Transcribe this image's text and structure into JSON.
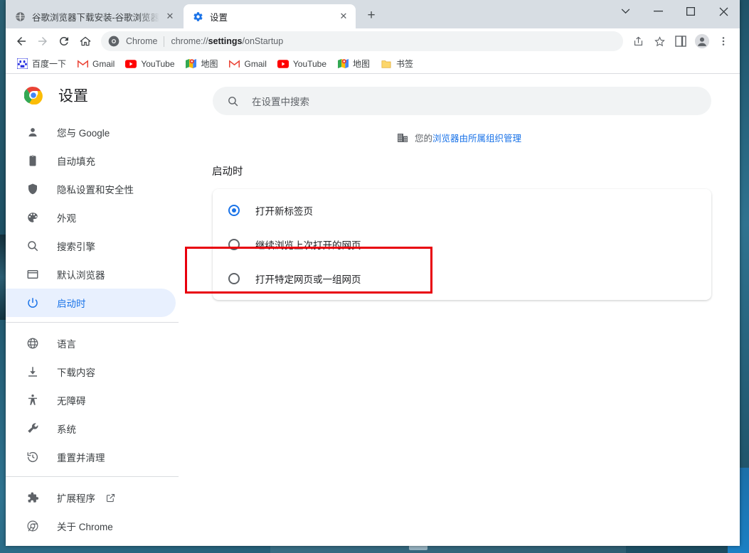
{
  "window": {
    "controls": [
      {
        "name": "tab-search",
        "glyph": "⌄"
      },
      {
        "name": "minimize",
        "glyph": "—"
      },
      {
        "name": "maximize",
        "glyph": "▢"
      },
      {
        "name": "close",
        "glyph": "✕"
      }
    ]
  },
  "tabs": [
    {
      "title": "谷歌浏览器下载安装-谷歌浏览器",
      "icon": "globe-icon",
      "active": false
    },
    {
      "title": "设置",
      "icon": "gear-icon",
      "active": true
    }
  ],
  "tab_close_glyph": "✕",
  "new_tab_glyph": "+",
  "toolbar": {
    "back_label": "←",
    "forward_label": "→",
    "reload_label": "⟳",
    "home_label": "⌂",
    "omnibox": {
      "scheme_label": "Chrome",
      "url_prefix": "chrome://",
      "url_bold": "settings",
      "url_suffix": "/onStartup",
      "full_url": "chrome://settings/onStartup"
    },
    "right_icons": [
      "share-icon",
      "star-icon",
      "side-panel-icon",
      "profile-avatar-icon",
      "more-menu-icon"
    ]
  },
  "bookmarks": [
    {
      "label": "百度一下",
      "icon": "baidu-icon"
    },
    {
      "label": "Gmail",
      "icon": "gmail-icon"
    },
    {
      "label": "YouTube",
      "icon": "youtube-icon"
    },
    {
      "label": "地图",
      "icon": "maps-icon"
    },
    {
      "label": "Gmail",
      "icon": "gmail-icon"
    },
    {
      "label": "YouTube",
      "icon": "youtube-icon"
    },
    {
      "label": "地图",
      "icon": "maps-icon"
    },
    {
      "label": "书签",
      "icon": "folder-icon"
    }
  ],
  "sidebar": {
    "title": "设置",
    "logo": "chrome-logo-icon",
    "group1": [
      {
        "label": "您与 Google",
        "icon": "person-icon",
        "active": false
      },
      {
        "label": "自动填充",
        "icon": "clipboard-icon",
        "active": false
      },
      {
        "label": "隐私设置和安全性",
        "icon": "shield-icon",
        "active": false
      },
      {
        "label": "外观",
        "icon": "palette-icon",
        "active": false
      },
      {
        "label": "搜索引擎",
        "icon": "search-icon",
        "active": false
      },
      {
        "label": "默认浏览器",
        "icon": "browser-window-icon",
        "active": false
      },
      {
        "label": "启动时",
        "icon": "power-icon",
        "active": true
      }
    ],
    "group2": [
      {
        "label": "语言",
        "icon": "globe-icon",
        "active": false
      },
      {
        "label": "下载内容",
        "icon": "download-icon",
        "active": false
      },
      {
        "label": "无障碍",
        "icon": "accessibility-icon",
        "active": false
      },
      {
        "label": "系统",
        "icon": "wrench-icon",
        "active": false
      },
      {
        "label": "重置并清理",
        "icon": "history-restore-icon",
        "active": false
      }
    ],
    "group3": [
      {
        "label": "扩展程序",
        "icon": "puzzle-icon",
        "external": true,
        "active": false
      },
      {
        "label": "关于 Chrome",
        "icon": "chrome-outline-icon",
        "external": false,
        "active": false
      }
    ]
  },
  "search": {
    "placeholder": "在设置中搜索",
    "icon": "search-icon"
  },
  "managed": {
    "icon": "organization-building-icon",
    "prefix": "您的",
    "link": "浏览器由所属组织管理"
  },
  "main": {
    "section_title": "启动时",
    "startup_options": [
      {
        "label": "打开新标签页",
        "checked": true,
        "highlighted": false
      },
      {
        "label": "继续浏览上次打开的网页",
        "checked": false,
        "highlighted": false
      },
      {
        "label": "打开特定网页或一组网页",
        "checked": false,
        "highlighted": true
      }
    ]
  },
  "colors": {
    "accent_blue": "#1a73e8",
    "active_nav_bg": "#e8f0fe",
    "annotation_red": "#e8000d",
    "tabstrip_bg": "#d7dde3",
    "omnibox_bg": "#f1f3f4"
  }
}
